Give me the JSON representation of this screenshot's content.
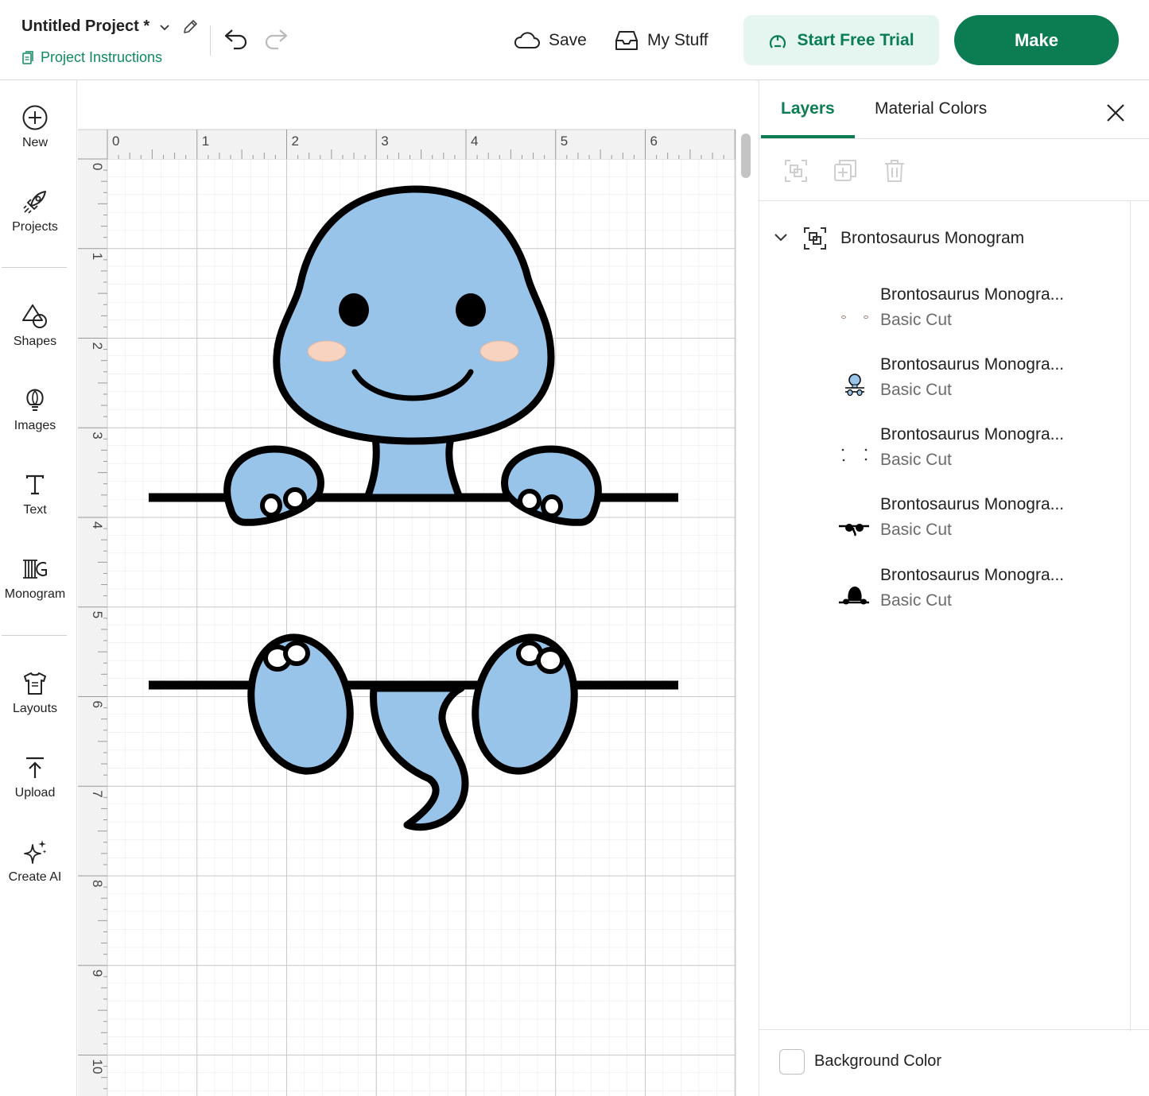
{
  "header": {
    "project_title": "Untitled Project *",
    "instructions_link": "Project Instructions",
    "save_label": "Save",
    "my_stuff_label": "My Stuff",
    "trial_label": "Start Free Trial",
    "make_label": "Make"
  },
  "toolbar": {
    "items": [
      {
        "label": "New",
        "icon": "plus-circle-icon"
      },
      {
        "label": "Projects",
        "icon": "rocket-icon"
      },
      {
        "label": "Shapes",
        "icon": "shapes-icon"
      },
      {
        "label": "Images",
        "icon": "lightbulb-icon"
      },
      {
        "label": "Text",
        "icon": "text-icon"
      },
      {
        "label": "Monogram",
        "icon": "monogram-icon"
      },
      {
        "label": "Layouts",
        "icon": "shirt-icon"
      },
      {
        "label": "Upload",
        "icon": "upload-icon"
      },
      {
        "label": "Create AI",
        "icon": "sparkle-icon"
      }
    ]
  },
  "canvas": {
    "ruler_top": [
      "0",
      "1",
      "2",
      "3",
      "4",
      "5",
      "6"
    ],
    "ruler_left": [
      "0",
      "1",
      "2",
      "3",
      "4",
      "5",
      "6",
      "7",
      "8",
      "9",
      "10"
    ],
    "design_colors": {
      "body": "#99c4ea",
      "outline": "#000000",
      "cheeks": "#f7d3c0"
    }
  },
  "panel": {
    "tabs": [
      "Layers",
      "Material Colors"
    ],
    "active_tab": "Layers",
    "group_name": "Brontosaurus Monogram",
    "layers": [
      {
        "name": "Brontosaurus Monogra...",
        "operation": "Basic Cut",
        "thumb": "cheeks"
      },
      {
        "name": "Brontosaurus Monogra...",
        "operation": "Basic Cut",
        "thumb": "full-color"
      },
      {
        "name": "Brontosaurus Monogra...",
        "operation": "Basic Cut",
        "thumb": "dots"
      },
      {
        "name": "Brontosaurus Monogra...",
        "operation": "Basic Cut",
        "thumb": "bottom-outline"
      },
      {
        "name": "Brontosaurus Monogra...",
        "operation": "Basic Cut",
        "thumb": "top-outline"
      }
    ],
    "background_color_label": "Background Color"
  },
  "colors": {
    "accent": "#0c7d52",
    "accent_light": "#e5f6f0"
  }
}
